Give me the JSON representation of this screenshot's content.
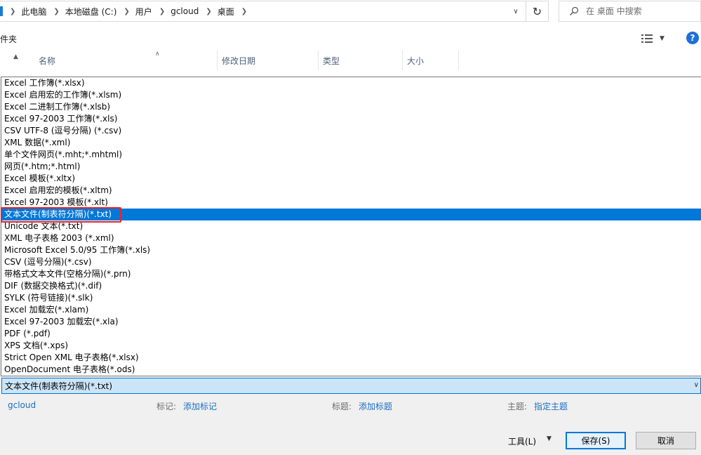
{
  "address": {
    "breadcrumb": [
      "此电脑",
      "本地磁盘 (C:)",
      "用户",
      "gcloud",
      "桌面"
    ],
    "search_placeholder": "在 桌面 中搜索"
  },
  "toolbar": {
    "folder_label": "件夹",
    "help": "?"
  },
  "columns": [
    {
      "label": "名称"
    },
    {
      "label": "修改日期"
    },
    {
      "label": "类型"
    },
    {
      "label": "大小"
    }
  ],
  "file_types": [
    "Excel 工作簿(*.xlsx)",
    "Excel 启用宏的工作簿(*.xlsm)",
    "Excel 二进制工作簿(*.xlsb)",
    "Excel 97-2003 工作簿(*.xls)",
    "CSV UTF-8 (逗号分隔) (*.csv)",
    "XML 数据(*.xml)",
    "单个文件网页(*.mht;*.mhtml)",
    "网页(*.htm;*.html)",
    "Excel 模板(*.xltx)",
    "Excel 启用宏的模板(*.xltm)",
    "Excel 97-2003 模板(*.xlt)",
    "文本文件(制表符分隔)(*.txt)",
    "Unicode 文本(*.txt)",
    "XML 电子表格 2003 (*.xml)",
    "Microsoft Excel 5.0/95 工作簿(*.xls)",
    "CSV (逗号分隔)(*.csv)",
    "带格式文本文件(空格分隔)(*.prn)",
    "DIF (数据交换格式)(*.dif)",
    "SYLK (符号链接)(*.slk)",
    "Excel 加载宏(*.xlam)",
    "Excel 97-2003 加载宏(*.xla)",
    "PDF (*.pdf)",
    "XPS 文档(*.xps)",
    "Strict Open XML 电子表格(*.xlsx)",
    "OpenDocument 电子表格(*.ods)"
  ],
  "selected_type_index": 11,
  "save_as_type": "文本文件(制表符分隔)(*.txt)",
  "meta": {
    "author": "gcloud",
    "tags_label": "标记:",
    "tags_link": "添加标记",
    "title_label": "标题:",
    "title_link": "添加标题",
    "subject_label": "主题:",
    "subject_link": "指定主题"
  },
  "buttons": {
    "tools": "工具(L)",
    "save": "保存(S)",
    "cancel": "取消"
  },
  "colors": {
    "selection": "#0078d7",
    "highlight_box": "#e8232b",
    "link": "#1a6ec0"
  }
}
